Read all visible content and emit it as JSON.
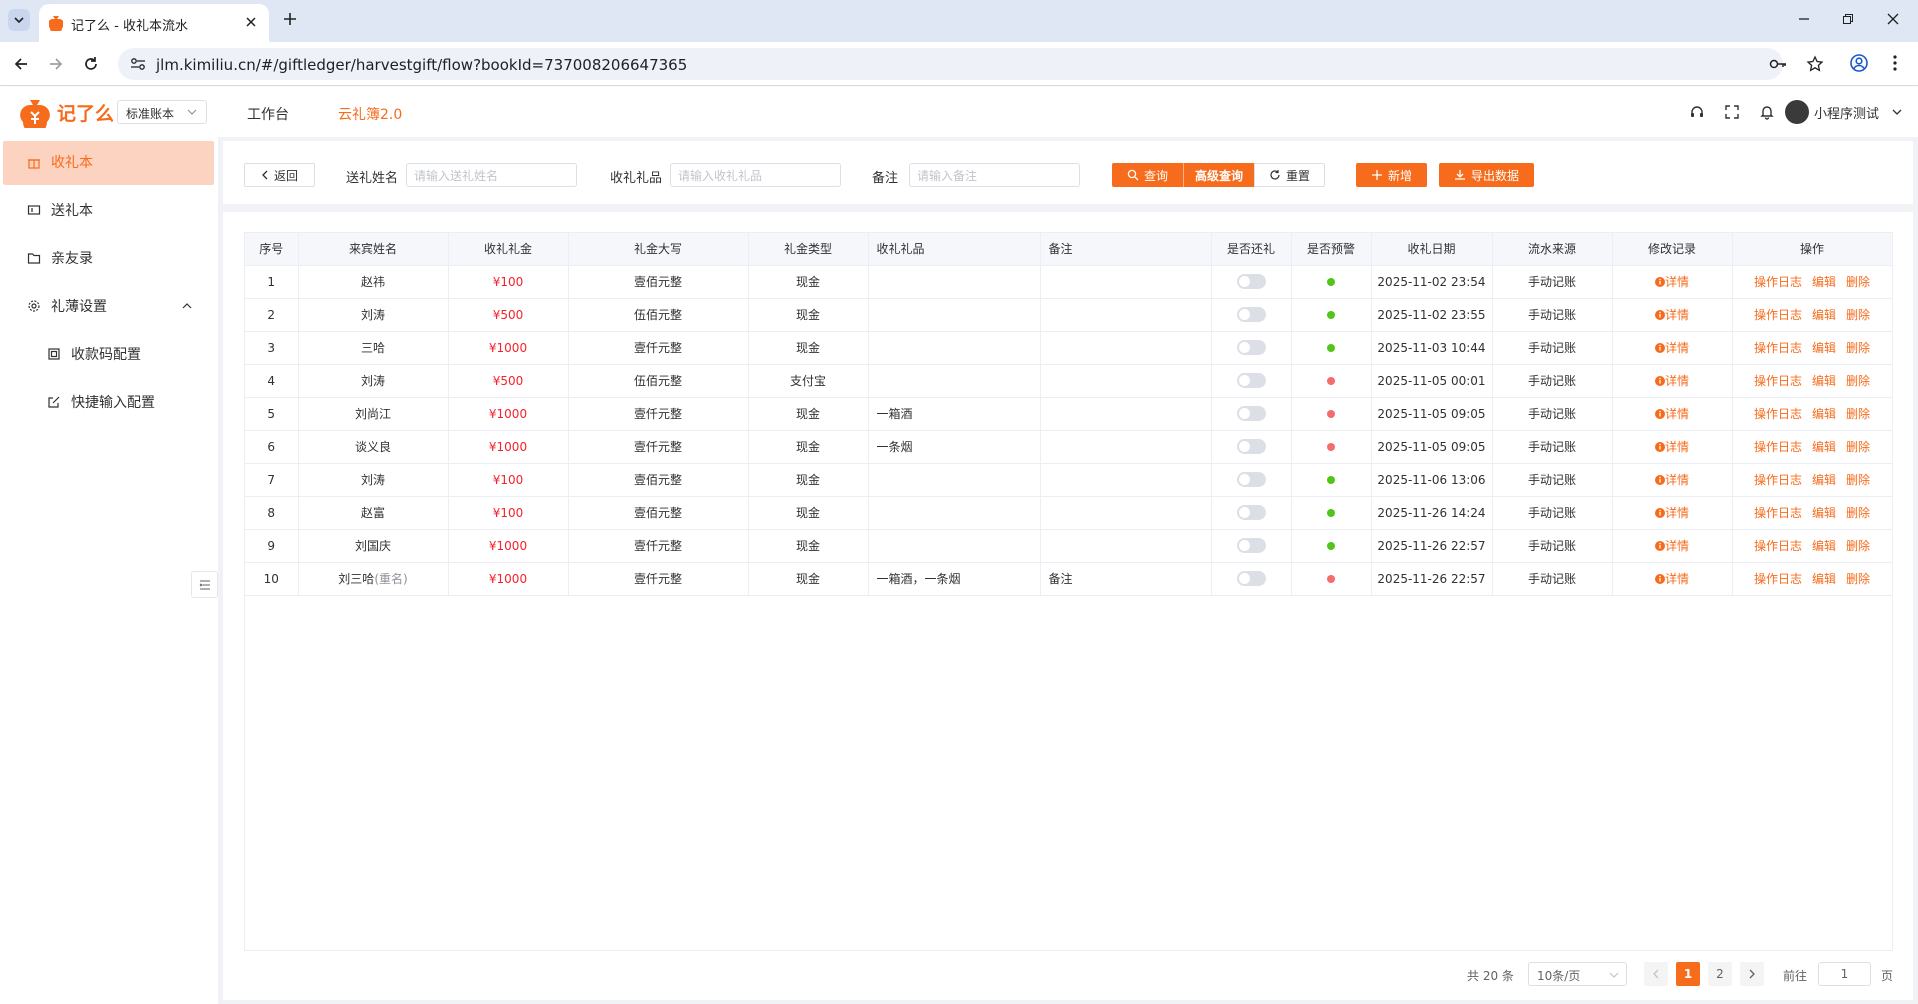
{
  "browser": {
    "tab_title": "记了么 - 收礼本流水",
    "url": "jlm.kimiliu.cn/#/giftledger/harvestgift/flow?bookId=737008206647365"
  },
  "header": {
    "logo_text": "记了么",
    "book_type": "标准账本",
    "nav_workbench": "工作台",
    "nav_cloud": "云礼簿2.0",
    "user_name": "小程序测试"
  },
  "sidebar": {
    "items": [
      {
        "label": "收礼本",
        "icon": "gift-icon"
      },
      {
        "label": "送礼本",
        "icon": "send-icon"
      },
      {
        "label": "亲友录",
        "icon": "folder-icon"
      },
      {
        "label": "礼薄设置",
        "icon": "gear-icon"
      },
      {
        "label": "收款码配置",
        "icon": "qrcode-icon"
      },
      {
        "label": "快捷输入配置",
        "icon": "edit-icon"
      }
    ]
  },
  "search": {
    "back_label": "返回",
    "sender_label": "送礼姓名",
    "sender_placeholder": "请输入送礼姓名",
    "gift_label": "收礼礼品",
    "gift_placeholder": "请输入收礼礼品",
    "remark_label": "备注",
    "remark_placeholder": "请输入备注",
    "query_label": "查询",
    "advanced_label": "高级查询",
    "reset_label": "重置",
    "add_label": "新增",
    "export_label": "导出数据"
  },
  "table": {
    "columns": [
      "序号",
      "来宾姓名",
      "收礼礼金",
      "礼金大写",
      "礼金类型",
      "收礼礼品",
      "备注",
      "是否还礼",
      "是否预警",
      "收礼日期",
      "流水来源",
      "修改记录",
      "操作"
    ],
    "detail_label": "详情",
    "op_log_label": "操作日志",
    "op_edit_label": "编辑",
    "op_delete_label": "删除",
    "dup_tag": "(重名)",
    "rows": [
      {
        "no": "1",
        "name": "赵祎",
        "amount": "¥100",
        "upper": "壹佰元整",
        "type": "现金",
        "gift": "",
        "remark": "",
        "returned": false,
        "warn": "green",
        "date": "2025-11-02 23:54",
        "source": "手动记账",
        "dup": false
      },
      {
        "no": "2",
        "name": "刘涛",
        "amount": "¥500",
        "upper": "伍佰元整",
        "type": "现金",
        "gift": "",
        "remark": "",
        "returned": false,
        "warn": "green",
        "date": "2025-11-02 23:55",
        "source": "手动记账",
        "dup": false
      },
      {
        "no": "3",
        "name": "三哈",
        "amount": "¥1000",
        "upper": "壹仟元整",
        "type": "现金",
        "gift": "",
        "remark": "",
        "returned": false,
        "warn": "green",
        "date": "2025-11-03 10:44",
        "source": "手动记账",
        "dup": false
      },
      {
        "no": "4",
        "name": "刘涛",
        "amount": "¥500",
        "upper": "伍佰元整",
        "type": "支付宝",
        "gift": "",
        "remark": "",
        "returned": false,
        "warn": "red",
        "date": "2025-11-05 00:01",
        "source": "手动记账",
        "dup": false
      },
      {
        "no": "5",
        "name": "刘尚江",
        "amount": "¥1000",
        "upper": "壹仟元整",
        "type": "现金",
        "gift": "一箱酒",
        "remark": "",
        "returned": false,
        "warn": "red",
        "date": "2025-11-05 09:05",
        "source": "手动记账",
        "dup": false
      },
      {
        "no": "6",
        "name": "谈义良",
        "amount": "¥1000",
        "upper": "壹仟元整",
        "type": "现金",
        "gift": "一条烟",
        "remark": "",
        "returned": false,
        "warn": "red",
        "date": "2025-11-05 09:05",
        "source": "手动记账",
        "dup": false
      },
      {
        "no": "7",
        "name": "刘涛",
        "amount": "¥100",
        "upper": "壹佰元整",
        "type": "现金",
        "gift": "",
        "remark": "",
        "returned": false,
        "warn": "green",
        "date": "2025-11-06 13:06",
        "source": "手动记账",
        "dup": false
      },
      {
        "no": "8",
        "name": "赵富",
        "amount": "¥100",
        "upper": "壹佰元整",
        "type": "现金",
        "gift": "",
        "remark": "",
        "returned": false,
        "warn": "green",
        "date": "2025-11-26 14:24",
        "source": "手动记账",
        "dup": false
      },
      {
        "no": "9",
        "name": "刘国庆",
        "amount": "¥1000",
        "upper": "壹仟元整",
        "type": "现金",
        "gift": "",
        "remark": "",
        "returned": false,
        "warn": "green",
        "date": "2025-11-26 22:57",
        "source": "手动记账",
        "dup": false
      },
      {
        "no": "10",
        "name": "刘三哈",
        "amount": "¥1000",
        "upper": "壹仟元整",
        "type": "现金",
        "gift": "一箱酒，一条烟",
        "remark": "备注",
        "returned": false,
        "warn": "red",
        "date": "2025-11-26 22:57",
        "source": "手动记账",
        "dup": true
      }
    ]
  },
  "pagination": {
    "total_text": "共 20 条",
    "page_size": "10条/页",
    "pages": [
      "1",
      "2"
    ],
    "current_page": "1",
    "goto_label": "前往",
    "goto_value": "1",
    "page_unit": "页"
  },
  "colors": {
    "accent": "#f76b1c",
    "money": "#f5222d",
    "warn_green": "#52c41a",
    "warn_red": "#f56c6c"
  }
}
